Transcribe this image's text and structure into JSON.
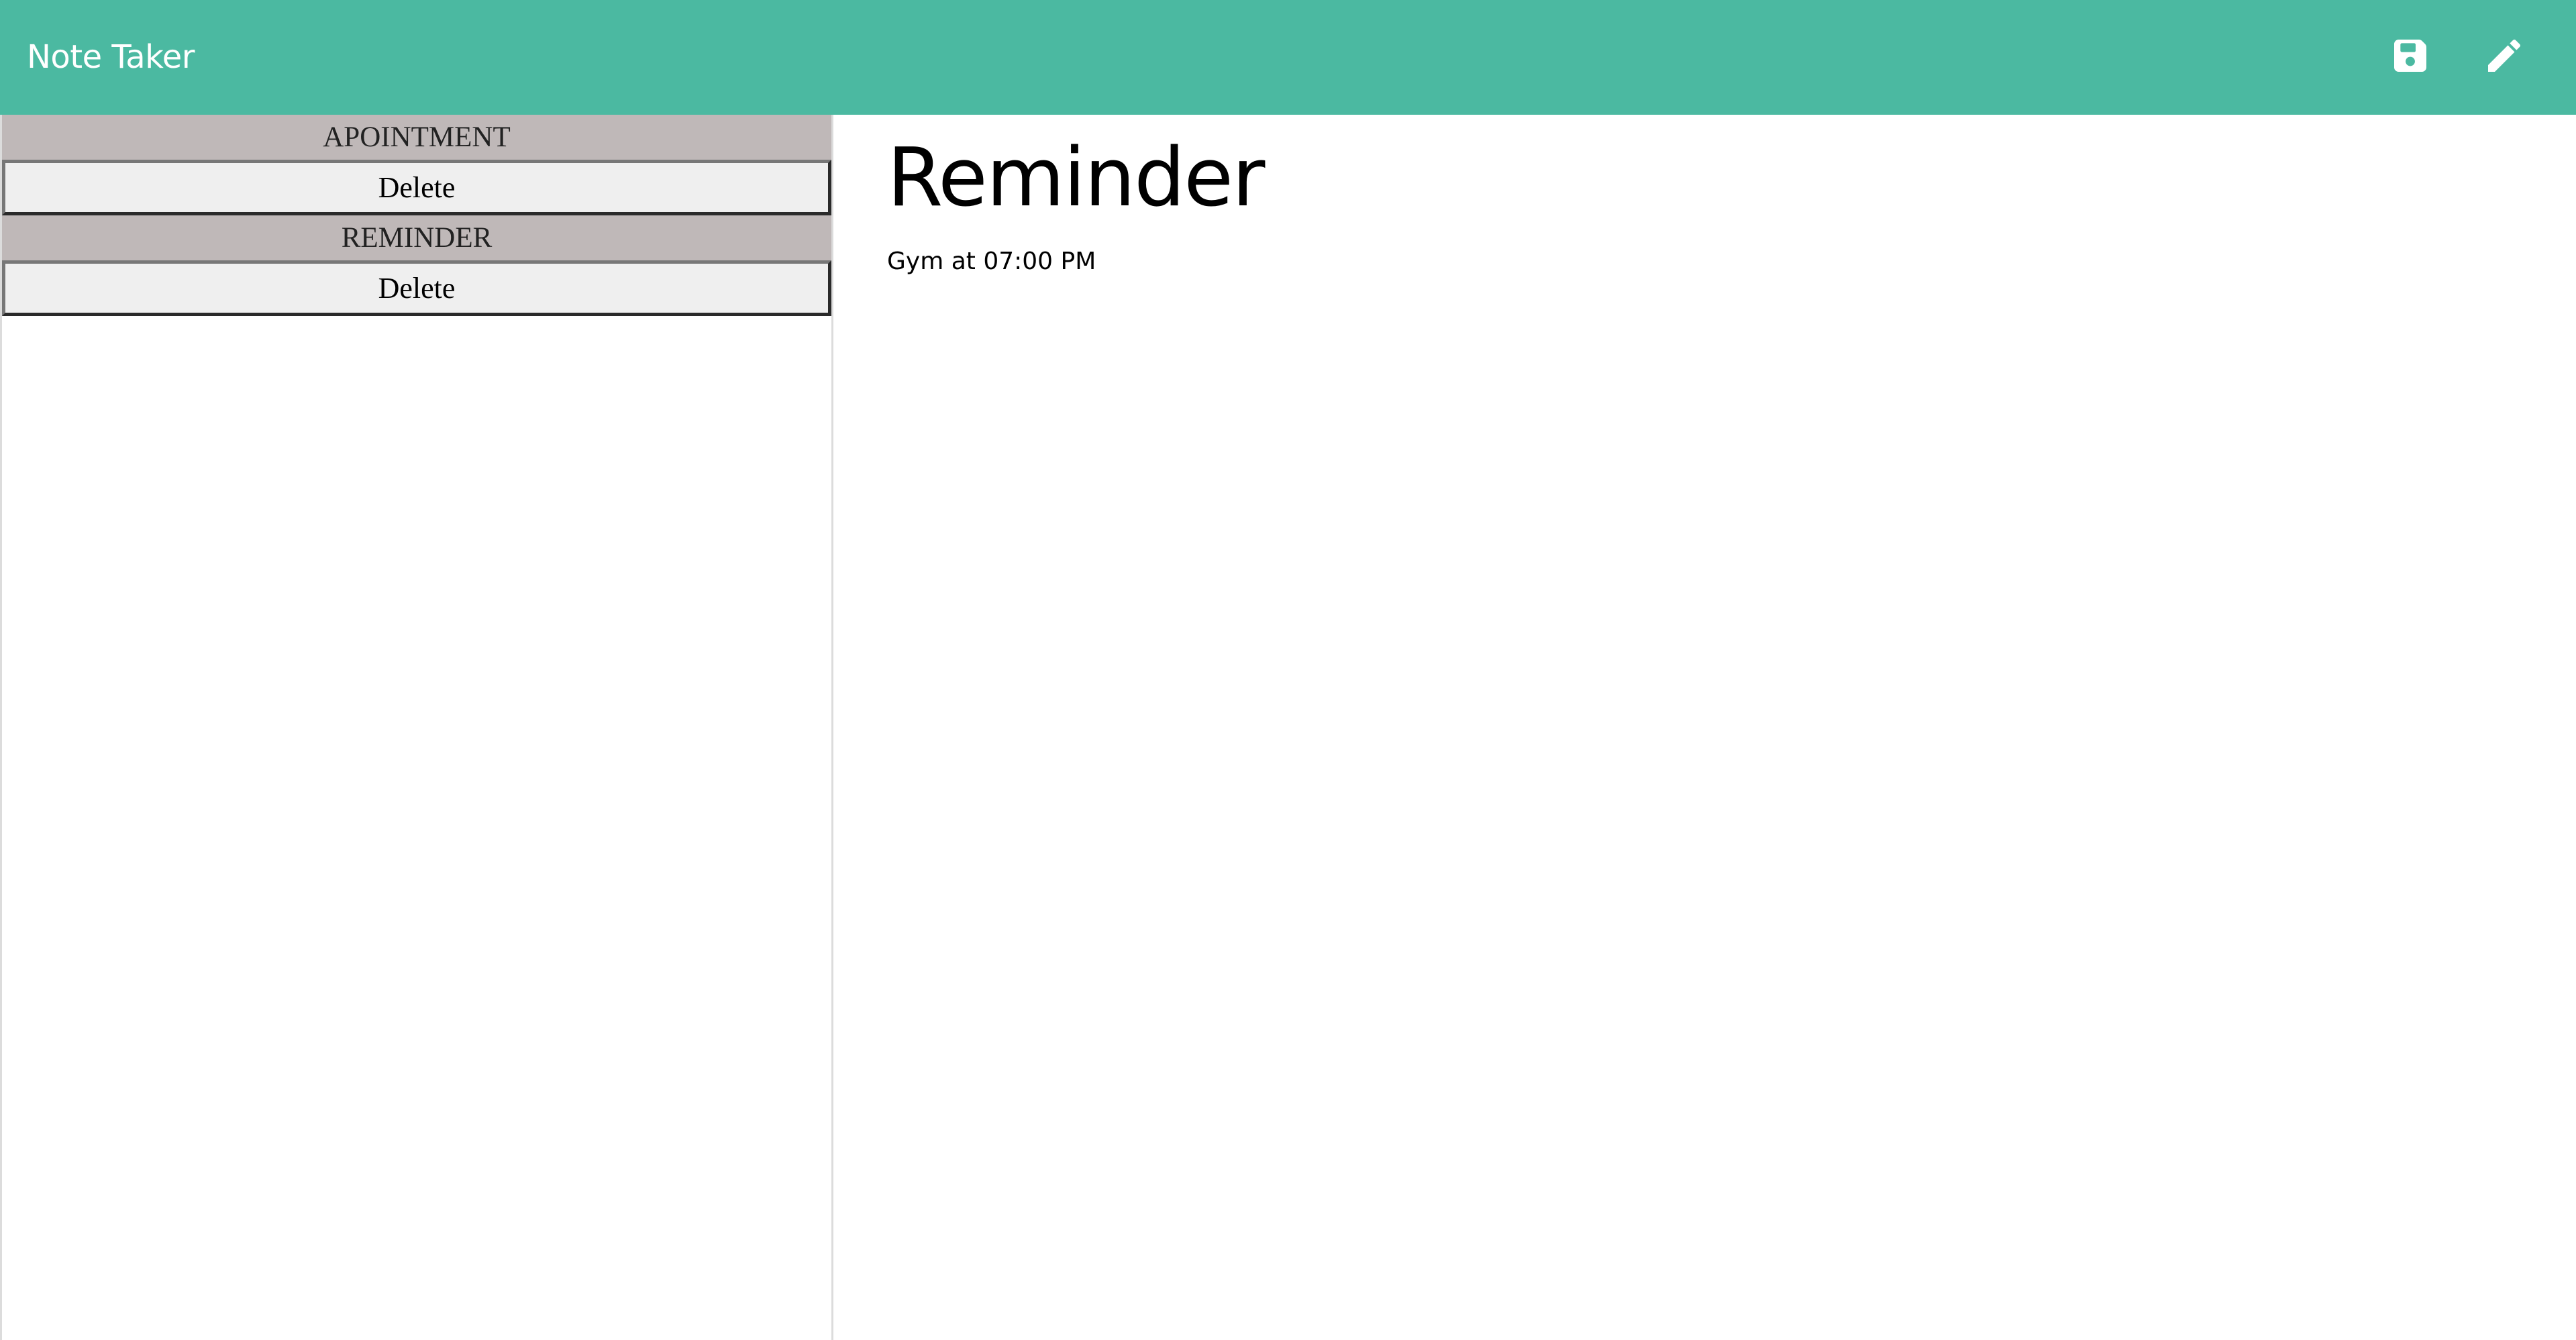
{
  "app": {
    "title": "Note Taker",
    "brand_color": "#4bb9a1"
  },
  "toolbar": {
    "save_icon": "floppy-disk-icon",
    "edit_icon": "pencil-icon"
  },
  "notes": [
    {
      "title": "APOINTMENT",
      "delete_label": "Delete"
    },
    {
      "title": "REMINDER",
      "delete_label": "Delete"
    }
  ],
  "active_note": {
    "title": "Reminder",
    "text": "Gym at 07:00 PM"
  }
}
